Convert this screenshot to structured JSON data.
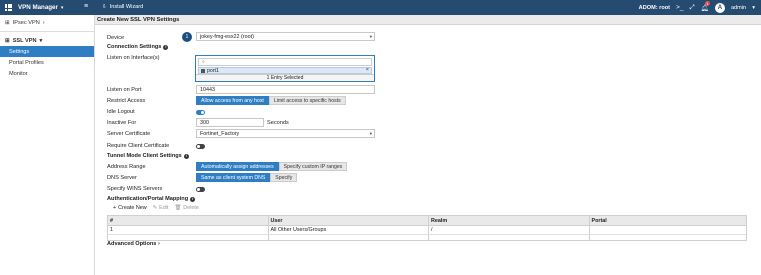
{
  "topbar": {
    "app_title": "VPN Manager",
    "wizard_label": "Install Wizard",
    "adom_label": "ADOM: root",
    "notification_count": "1",
    "user_initial": "A",
    "user_name": "admin"
  },
  "sidebar": {
    "ipsec_label": "IPsec VPN",
    "sslvpn_label": "SSL VPN",
    "items": [
      {
        "label": "Settings"
      },
      {
        "label": "Portal Profiles"
      },
      {
        "label": "Monitor"
      }
    ]
  },
  "page": {
    "title": "Create New SSL VPN Settings",
    "step_number": "1"
  },
  "form": {
    "device_label": "Device",
    "device_value": "jokey-fmg-esx22 (root)",
    "connection_section": "Connection Settings",
    "listen_interfaces_label": "Listen on Interface(s)",
    "interface_chip": "port1",
    "interface_footer": "1 Entry Selected",
    "listen_port_label": "Listen on Port",
    "listen_port_value": "10443",
    "restrict_label": "Restrict Access",
    "restrict_opt1": "Allow access from any host",
    "restrict_opt2": "Limit access to specific hosts",
    "idle_label": "Idle Logout",
    "inactive_label": "Inactive For",
    "inactive_value": "300",
    "inactive_unit": "Seconds",
    "cert_label": "Server Certificate",
    "cert_value": "Fortinet_Factory",
    "client_cert_label": "Require Client Certificate",
    "tunnel_section": "Tunnel Mode Client Settings",
    "address_label": "Address Range",
    "address_opt1": "Automatically assign addresses",
    "address_opt2": "Specify custom IP ranges",
    "dns_label": "DNS Server",
    "dns_opt1": "Same as client system DNS",
    "dns_opt2": "Specify",
    "wins_label": "Specify WINS Servers",
    "auth_section": "Authentication/Portal Mapping"
  },
  "toolbar": {
    "create_label": "Create New",
    "edit_label": "Edit",
    "delete_label": "Delete"
  },
  "table": {
    "headers": [
      "#",
      "User",
      "Realm",
      "Portal"
    ],
    "rows": [
      [
        "1",
        "All Other Users/Groups",
        "/",
        ""
      ]
    ]
  },
  "advanced_label": "Advanced Options",
  "colors": {
    "topbar": "#264b70",
    "accent": "#2f7ec4"
  }
}
